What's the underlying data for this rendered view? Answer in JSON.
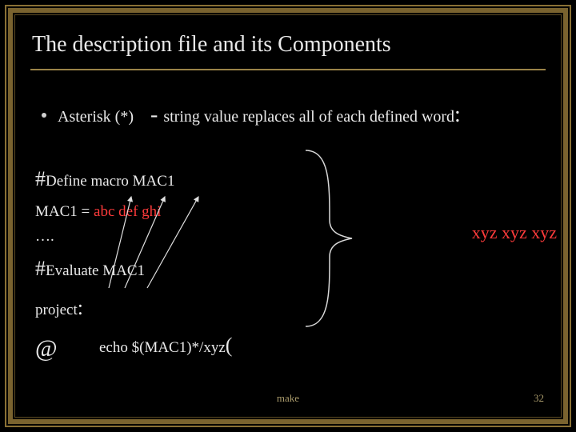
{
  "title": "The description file and its Components",
  "bullet": {
    "lead": "Asterisk (*)",
    "dash": "   - ",
    "rest": "string value replaces all of each defined word",
    "colon": ":"
  },
  "code": {
    "define_hash": "#",
    "define_text": "Define macro MAC1",
    "mac_prefix": "MAC1 =  ",
    "mac_a": "abc",
    "sep1": "   ",
    "mac_b": "def",
    "sep2": "   ",
    "mac_c": "ghi",
    "dots": "….",
    "eval_hash": "#",
    "eval_text": "Evaluate MAC1",
    "project_text": "project",
    "project_colon": ":",
    "at": "@",
    "echo": "echo $(MAC1)*/xyz",
    "paren": "("
  },
  "output": "xyz  xyz  xyz",
  "footer": {
    "title": "make",
    "page": "32"
  },
  "colors": {
    "accent": "#9a8348",
    "red": "#ff3b3b"
  }
}
